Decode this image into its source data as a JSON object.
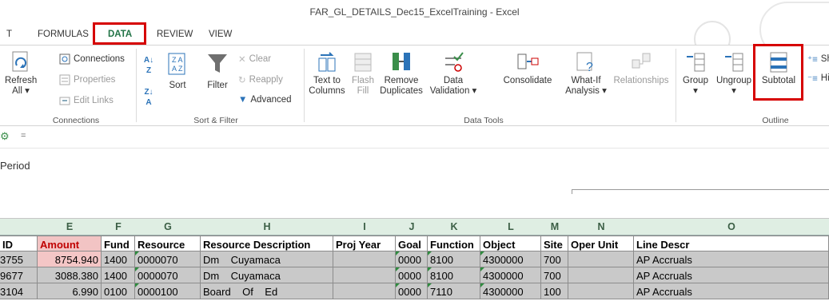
{
  "window": {
    "title": "FAR_GL_DETAILS_Dec15_ExcelTraining - Excel"
  },
  "tabs": [
    {
      "label": "T"
    },
    {
      "label": "FORMULAS"
    },
    {
      "label": "DATA"
    },
    {
      "label": "REVIEW"
    },
    {
      "label": "VIEW"
    }
  ],
  "ribbon": {
    "connections": {
      "refresh_label": "Refresh",
      "refresh_sub": "All",
      "connections": "Connections",
      "properties": "Properties",
      "edit_links": "Edit Links",
      "group_label": "Connections"
    },
    "sort_filter": {
      "sort": "Sort",
      "filter": "Filter",
      "clear": "Clear",
      "reapply": "Reapply",
      "advanced": "Advanced",
      "group_label": "Sort & Filter"
    },
    "data_tools": {
      "text_to_1": "Text to",
      "text_to_2": "Columns",
      "flash_1": "Flash",
      "flash_2": "Fill",
      "remove_1": "Remove",
      "remove_2": "Duplicates",
      "validation_1": "Data",
      "validation_2": "Validation",
      "consolidate": "Consolidate",
      "whatif_1": "What-If",
      "whatif_2": "Analysis",
      "relationships": "Relationships",
      "group_label": "Data Tools"
    },
    "outline": {
      "group": "Group",
      "ungroup": "Ungroup",
      "subtotal": "Subtotal",
      "show": "Sh",
      "hide": "Hi",
      "group_label": "Outline"
    }
  },
  "qat": {
    "dropdown": "="
  },
  "formula_area": {
    "period_text": "Period"
  },
  "column_headers": [
    "E",
    "F",
    "G",
    "H",
    "I",
    "J",
    "K",
    "L",
    "M",
    "N",
    "O"
  ],
  "table": {
    "headers": [
      "ID",
      "Amount",
      "Fund",
      "Resource",
      "Resource Description",
      "Proj Year",
      "Goal",
      "Function",
      "Object",
      "Site",
      "Oper Unit",
      "Line Descr"
    ],
    "rows": [
      [
        "3755",
        "8754.940",
        "1400",
        "0000070",
        "Dm    Cuyamaca",
        "",
        "0000",
        "8100",
        "4300000",
        "700",
        "",
        "AP Accruals"
      ],
      [
        "9677",
        "3088.380",
        "1400",
        "0000070",
        "Dm    Cuyamaca",
        "",
        "0000",
        "8100",
        "4300000",
        "700",
        "",
        "AP Accruals"
      ],
      [
        "3104",
        "6.990",
        "0100",
        "0000100",
        "Board    Of    Ed",
        "",
        "0000",
        "7110",
        "4300000",
        "100",
        "",
        "AP Accruals"
      ]
    ]
  },
  "colors": {
    "accent": "#217346",
    "highlight_box": "#d60000",
    "amount_highlight": "#f4c6c6"
  }
}
